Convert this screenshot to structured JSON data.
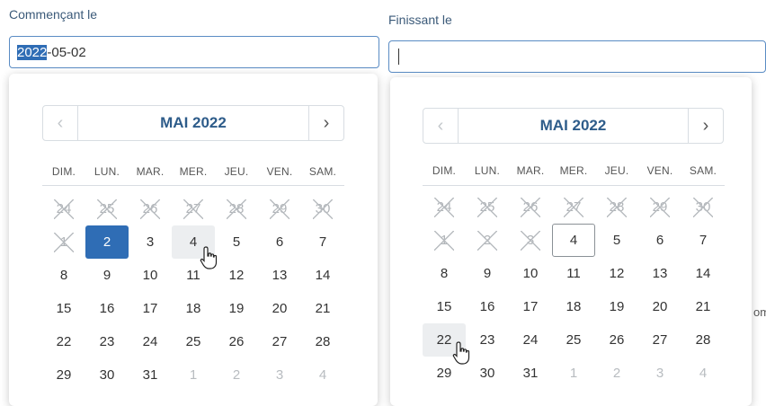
{
  "start": {
    "label": "Commençant le",
    "input": {
      "selected_text": "2022",
      "rest_text": "-05-02"
    },
    "calendar": {
      "month_title": "MAI 2022",
      "prev_icon": "chevron-left-icon",
      "next_icon": "chevron-right-icon",
      "weekdays": [
        "DIM.",
        "LUN.",
        "MAR.",
        "MER.",
        "JEU.",
        "VEN.",
        "SAM."
      ],
      "days": [
        {
          "d": "24",
          "s": "disabled"
        },
        {
          "d": "25",
          "s": "disabled"
        },
        {
          "d": "26",
          "s": "disabled"
        },
        {
          "d": "27",
          "s": "disabled"
        },
        {
          "d": "28",
          "s": "disabled"
        },
        {
          "d": "29",
          "s": "disabled"
        },
        {
          "d": "30",
          "s": "disabled"
        },
        {
          "d": "1",
          "s": "disabled"
        },
        {
          "d": "2",
          "s": "selected"
        },
        {
          "d": "3",
          "s": ""
        },
        {
          "d": "4",
          "s": "hovered"
        },
        {
          "d": "5",
          "s": ""
        },
        {
          "d": "6",
          "s": ""
        },
        {
          "d": "7",
          "s": ""
        },
        {
          "d": "8",
          "s": ""
        },
        {
          "d": "9",
          "s": ""
        },
        {
          "d": "10",
          "s": ""
        },
        {
          "d": "11",
          "s": ""
        },
        {
          "d": "12",
          "s": ""
        },
        {
          "d": "13",
          "s": ""
        },
        {
          "d": "14",
          "s": ""
        },
        {
          "d": "15",
          "s": ""
        },
        {
          "d": "16",
          "s": ""
        },
        {
          "d": "17",
          "s": ""
        },
        {
          "d": "18",
          "s": ""
        },
        {
          "d": "19",
          "s": ""
        },
        {
          "d": "20",
          "s": ""
        },
        {
          "d": "21",
          "s": ""
        },
        {
          "d": "22",
          "s": ""
        },
        {
          "d": "23",
          "s": ""
        },
        {
          "d": "24",
          "s": ""
        },
        {
          "d": "25",
          "s": ""
        },
        {
          "d": "26",
          "s": ""
        },
        {
          "d": "27",
          "s": ""
        },
        {
          "d": "28",
          "s": ""
        },
        {
          "d": "29",
          "s": ""
        },
        {
          "d": "30",
          "s": ""
        },
        {
          "d": "31",
          "s": ""
        },
        {
          "d": "1",
          "s": "other"
        },
        {
          "d": "2",
          "s": "other"
        },
        {
          "d": "3",
          "s": "other"
        },
        {
          "d": "4",
          "s": "other"
        }
      ]
    }
  },
  "end": {
    "label": "Finissant le",
    "input": {
      "value": ""
    },
    "calendar": {
      "month_title": "MAI 2022",
      "prev_icon": "chevron-left-icon",
      "next_icon": "chevron-right-icon",
      "weekdays": [
        "DIM.",
        "LUN.",
        "MAR.",
        "MER.",
        "JEU.",
        "VEN.",
        "SAM."
      ],
      "days": [
        {
          "d": "24",
          "s": "disabled"
        },
        {
          "d": "25",
          "s": "disabled"
        },
        {
          "d": "26",
          "s": "disabled"
        },
        {
          "d": "27",
          "s": "disabled"
        },
        {
          "d": "28",
          "s": "disabled"
        },
        {
          "d": "29",
          "s": "disabled"
        },
        {
          "d": "30",
          "s": "disabled"
        },
        {
          "d": "1",
          "s": "disabled"
        },
        {
          "d": "2",
          "s": "disabled"
        },
        {
          "d": "3",
          "s": "disabled"
        },
        {
          "d": "4",
          "s": "outlined"
        },
        {
          "d": "5",
          "s": ""
        },
        {
          "d": "6",
          "s": ""
        },
        {
          "d": "7",
          "s": ""
        },
        {
          "d": "8",
          "s": ""
        },
        {
          "d": "9",
          "s": ""
        },
        {
          "d": "10",
          "s": ""
        },
        {
          "d": "11",
          "s": ""
        },
        {
          "d": "12",
          "s": ""
        },
        {
          "d": "13",
          "s": ""
        },
        {
          "d": "14",
          "s": ""
        },
        {
          "d": "15",
          "s": ""
        },
        {
          "d": "16",
          "s": ""
        },
        {
          "d": "17",
          "s": ""
        },
        {
          "d": "18",
          "s": ""
        },
        {
          "d": "19",
          "s": ""
        },
        {
          "d": "20",
          "s": ""
        },
        {
          "d": "21",
          "s": ""
        },
        {
          "d": "22",
          "s": "hovered"
        },
        {
          "d": "23",
          "s": ""
        },
        {
          "d": "24",
          "s": ""
        },
        {
          "d": "25",
          "s": ""
        },
        {
          "d": "26",
          "s": ""
        },
        {
          "d": "27",
          "s": ""
        },
        {
          "d": "28",
          "s": ""
        },
        {
          "d": "29",
          "s": ""
        },
        {
          "d": "30",
          "s": ""
        },
        {
          "d": "31",
          "s": ""
        },
        {
          "d": "1",
          "s": "other"
        },
        {
          "d": "2",
          "s": "other"
        },
        {
          "d": "3",
          "s": "other"
        },
        {
          "d": "4",
          "s": "other"
        }
      ]
    }
  },
  "background_fragment": "om",
  "colors": {
    "accent": "#2f6db5",
    "title": "#2e5c8a",
    "label": "#3b5a79"
  }
}
